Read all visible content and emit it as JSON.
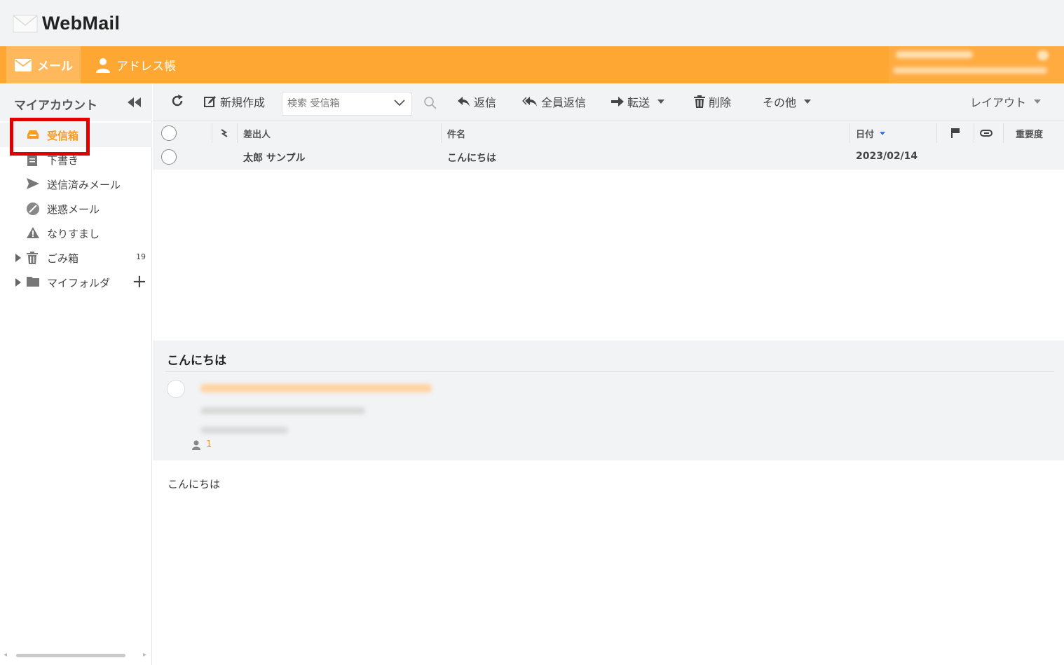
{
  "app": {
    "title": "WebMail"
  },
  "nav": {
    "mail": "メール",
    "address_book": "アドレス帳"
  },
  "sidebar": {
    "account_title": "マイアカウント",
    "folders": [
      {
        "label": "受信箱",
        "icon": "inbox-icon"
      },
      {
        "label": "下書き",
        "icon": "draft-icon"
      },
      {
        "label": "送信済みメール",
        "icon": "sent-icon"
      },
      {
        "label": "迷惑メール",
        "icon": "spam-icon"
      },
      {
        "label": "なりすまし",
        "icon": "warning-icon"
      },
      {
        "label": "ごみ箱",
        "icon": "trash-icon",
        "count": "19"
      },
      {
        "label": "マイフォルダ",
        "icon": "folder-icon"
      }
    ]
  },
  "toolbar": {
    "new": "新規作成",
    "search_placeholder": "検索 受信箱",
    "reply": "返信",
    "reply_all": "全員返信",
    "forward": "転送",
    "delete": "削除",
    "more": "その他",
    "layout": "レイアウト"
  },
  "list": {
    "columns": {
      "from": "差出人",
      "subject": "件名",
      "date": "日付",
      "importance": "重要度"
    },
    "rows": [
      {
        "from": "太郎 サンプル",
        "subject": "こんにちは",
        "date": "2023/02/14"
      }
    ]
  },
  "preview": {
    "subject": "こんにちは",
    "recipient_count": "1",
    "body": "こんにちは"
  },
  "colors": {
    "accent": "#ffa733",
    "highlight": "#e00000",
    "active_text": "#ff9a1f"
  }
}
